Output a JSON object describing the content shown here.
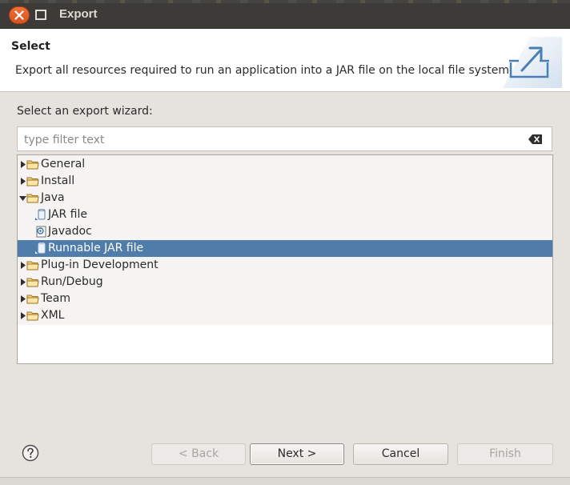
{
  "window": {
    "title": "Export"
  },
  "banner": {
    "title": "Select",
    "description": "Export all resources required to run an application into a JAR file on the local file system."
  },
  "wizard": {
    "label": "Select an export wizard:",
    "filter_placeholder": "type filter text",
    "filter_value": ""
  },
  "tree": [
    {
      "label": "General",
      "expanded": false,
      "icon": "folder-icon"
    },
    {
      "label": "Install",
      "expanded": false,
      "icon": "folder-icon"
    },
    {
      "label": "Java",
      "expanded": true,
      "icon": "folder-icon"
    },
    {
      "label": "JAR file",
      "child": true,
      "icon": "jar-icon"
    },
    {
      "label": "Javadoc",
      "child": true,
      "icon": "javadoc-icon"
    },
    {
      "label": "Runnable JAR file",
      "child": true,
      "selected": true,
      "icon": "runnable-jar-icon"
    },
    {
      "label": "Plug-in Development",
      "expanded": false,
      "icon": "folder-icon"
    },
    {
      "label": "Run/Debug",
      "expanded": false,
      "icon": "folder-icon"
    },
    {
      "label": "Team",
      "expanded": false,
      "icon": "folder-icon"
    },
    {
      "label": "XML",
      "expanded": false,
      "icon": "folder-icon"
    }
  ],
  "buttons": {
    "back": "< Back",
    "next": "Next >",
    "cancel": "Cancel",
    "finish": "Finish"
  },
  "colors": {
    "selection": "#4f7ca9",
    "titlebar": "#3c3b37",
    "close_button": "#e9622a"
  }
}
